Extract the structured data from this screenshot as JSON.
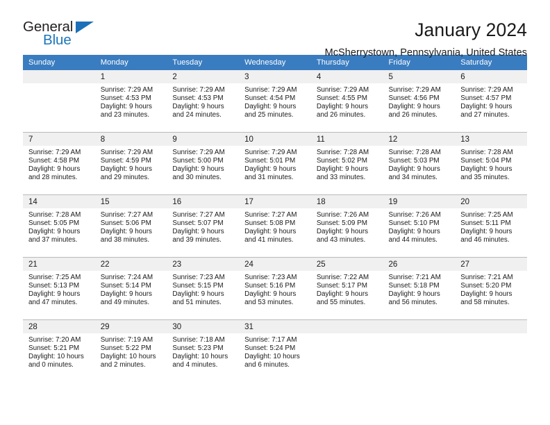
{
  "brand": {
    "name_top": "General",
    "name_bottom": "Blue",
    "triangle_color": "#1d70b8",
    "text_color": "#231f20",
    "blue_color": "#1b75bb"
  },
  "header": {
    "title": "January 2024",
    "subtitle": "McSherrystown, Pennsylvania, United States"
  },
  "calendar": {
    "header_bg": "#3a7cc0",
    "header_text_color": "#ffffff",
    "daynum_bg": "#f0f0f0",
    "weekdays": [
      "Sunday",
      "Monday",
      "Tuesday",
      "Wednesday",
      "Thursday",
      "Friday",
      "Saturday"
    ],
    "weeks": [
      [
        {
          "day": "",
          "sunrise": "",
          "sunset": "",
          "daylight_line1": "",
          "daylight_line2": ""
        },
        {
          "day": "1",
          "sunrise": "Sunrise: 7:29 AM",
          "sunset": "Sunset: 4:53 PM",
          "daylight_line1": "Daylight: 9 hours",
          "daylight_line2": "and 23 minutes."
        },
        {
          "day": "2",
          "sunrise": "Sunrise: 7:29 AM",
          "sunset": "Sunset: 4:53 PM",
          "daylight_line1": "Daylight: 9 hours",
          "daylight_line2": "and 24 minutes."
        },
        {
          "day": "3",
          "sunrise": "Sunrise: 7:29 AM",
          "sunset": "Sunset: 4:54 PM",
          "daylight_line1": "Daylight: 9 hours",
          "daylight_line2": "and 25 minutes."
        },
        {
          "day": "4",
          "sunrise": "Sunrise: 7:29 AM",
          "sunset": "Sunset: 4:55 PM",
          "daylight_line1": "Daylight: 9 hours",
          "daylight_line2": "and 26 minutes."
        },
        {
          "day": "5",
          "sunrise": "Sunrise: 7:29 AM",
          "sunset": "Sunset: 4:56 PM",
          "daylight_line1": "Daylight: 9 hours",
          "daylight_line2": "and 26 minutes."
        },
        {
          "day": "6",
          "sunrise": "Sunrise: 7:29 AM",
          "sunset": "Sunset: 4:57 PM",
          "daylight_line1": "Daylight: 9 hours",
          "daylight_line2": "and 27 minutes."
        }
      ],
      [
        {
          "day": "7",
          "sunrise": "Sunrise: 7:29 AM",
          "sunset": "Sunset: 4:58 PM",
          "daylight_line1": "Daylight: 9 hours",
          "daylight_line2": "and 28 minutes."
        },
        {
          "day": "8",
          "sunrise": "Sunrise: 7:29 AM",
          "sunset": "Sunset: 4:59 PM",
          "daylight_line1": "Daylight: 9 hours",
          "daylight_line2": "and 29 minutes."
        },
        {
          "day": "9",
          "sunrise": "Sunrise: 7:29 AM",
          "sunset": "Sunset: 5:00 PM",
          "daylight_line1": "Daylight: 9 hours",
          "daylight_line2": "and 30 minutes."
        },
        {
          "day": "10",
          "sunrise": "Sunrise: 7:29 AM",
          "sunset": "Sunset: 5:01 PM",
          "daylight_line1": "Daylight: 9 hours",
          "daylight_line2": "and 31 minutes."
        },
        {
          "day": "11",
          "sunrise": "Sunrise: 7:28 AM",
          "sunset": "Sunset: 5:02 PM",
          "daylight_line1": "Daylight: 9 hours",
          "daylight_line2": "and 33 minutes."
        },
        {
          "day": "12",
          "sunrise": "Sunrise: 7:28 AM",
          "sunset": "Sunset: 5:03 PM",
          "daylight_line1": "Daylight: 9 hours",
          "daylight_line2": "and 34 minutes."
        },
        {
          "day": "13",
          "sunrise": "Sunrise: 7:28 AM",
          "sunset": "Sunset: 5:04 PM",
          "daylight_line1": "Daylight: 9 hours",
          "daylight_line2": "and 35 minutes."
        }
      ],
      [
        {
          "day": "14",
          "sunrise": "Sunrise: 7:28 AM",
          "sunset": "Sunset: 5:05 PM",
          "daylight_line1": "Daylight: 9 hours",
          "daylight_line2": "and 37 minutes."
        },
        {
          "day": "15",
          "sunrise": "Sunrise: 7:27 AM",
          "sunset": "Sunset: 5:06 PM",
          "daylight_line1": "Daylight: 9 hours",
          "daylight_line2": "and 38 minutes."
        },
        {
          "day": "16",
          "sunrise": "Sunrise: 7:27 AM",
          "sunset": "Sunset: 5:07 PM",
          "daylight_line1": "Daylight: 9 hours",
          "daylight_line2": "and 39 minutes."
        },
        {
          "day": "17",
          "sunrise": "Sunrise: 7:27 AM",
          "sunset": "Sunset: 5:08 PM",
          "daylight_line1": "Daylight: 9 hours",
          "daylight_line2": "and 41 minutes."
        },
        {
          "day": "18",
          "sunrise": "Sunrise: 7:26 AM",
          "sunset": "Sunset: 5:09 PM",
          "daylight_line1": "Daylight: 9 hours",
          "daylight_line2": "and 43 minutes."
        },
        {
          "day": "19",
          "sunrise": "Sunrise: 7:26 AM",
          "sunset": "Sunset: 5:10 PM",
          "daylight_line1": "Daylight: 9 hours",
          "daylight_line2": "and 44 minutes."
        },
        {
          "day": "20",
          "sunrise": "Sunrise: 7:25 AM",
          "sunset": "Sunset: 5:11 PM",
          "daylight_line1": "Daylight: 9 hours",
          "daylight_line2": "and 46 minutes."
        }
      ],
      [
        {
          "day": "21",
          "sunrise": "Sunrise: 7:25 AM",
          "sunset": "Sunset: 5:13 PM",
          "daylight_line1": "Daylight: 9 hours",
          "daylight_line2": "and 47 minutes."
        },
        {
          "day": "22",
          "sunrise": "Sunrise: 7:24 AM",
          "sunset": "Sunset: 5:14 PM",
          "daylight_line1": "Daylight: 9 hours",
          "daylight_line2": "and 49 minutes."
        },
        {
          "day": "23",
          "sunrise": "Sunrise: 7:23 AM",
          "sunset": "Sunset: 5:15 PM",
          "daylight_line1": "Daylight: 9 hours",
          "daylight_line2": "and 51 minutes."
        },
        {
          "day": "24",
          "sunrise": "Sunrise: 7:23 AM",
          "sunset": "Sunset: 5:16 PM",
          "daylight_line1": "Daylight: 9 hours",
          "daylight_line2": "and 53 minutes."
        },
        {
          "day": "25",
          "sunrise": "Sunrise: 7:22 AM",
          "sunset": "Sunset: 5:17 PM",
          "daylight_line1": "Daylight: 9 hours",
          "daylight_line2": "and 55 minutes."
        },
        {
          "day": "26",
          "sunrise": "Sunrise: 7:21 AM",
          "sunset": "Sunset: 5:18 PM",
          "daylight_line1": "Daylight: 9 hours",
          "daylight_line2": "and 56 minutes."
        },
        {
          "day": "27",
          "sunrise": "Sunrise: 7:21 AM",
          "sunset": "Sunset: 5:20 PM",
          "daylight_line1": "Daylight: 9 hours",
          "daylight_line2": "and 58 minutes."
        }
      ],
      [
        {
          "day": "28",
          "sunrise": "Sunrise: 7:20 AM",
          "sunset": "Sunset: 5:21 PM",
          "daylight_line1": "Daylight: 10 hours",
          "daylight_line2": "and 0 minutes."
        },
        {
          "day": "29",
          "sunrise": "Sunrise: 7:19 AM",
          "sunset": "Sunset: 5:22 PM",
          "daylight_line1": "Daylight: 10 hours",
          "daylight_line2": "and 2 minutes."
        },
        {
          "day": "30",
          "sunrise": "Sunrise: 7:18 AM",
          "sunset": "Sunset: 5:23 PM",
          "daylight_line1": "Daylight: 10 hours",
          "daylight_line2": "and 4 minutes."
        },
        {
          "day": "31",
          "sunrise": "Sunrise: 7:17 AM",
          "sunset": "Sunset: 5:24 PM",
          "daylight_line1": "Daylight: 10 hours",
          "daylight_line2": "and 6 minutes."
        },
        {
          "day": "",
          "sunrise": "",
          "sunset": "",
          "daylight_line1": "",
          "daylight_line2": ""
        },
        {
          "day": "",
          "sunrise": "",
          "sunset": "",
          "daylight_line1": "",
          "daylight_line2": ""
        },
        {
          "day": "",
          "sunrise": "",
          "sunset": "",
          "daylight_line1": "",
          "daylight_line2": ""
        }
      ]
    ]
  }
}
